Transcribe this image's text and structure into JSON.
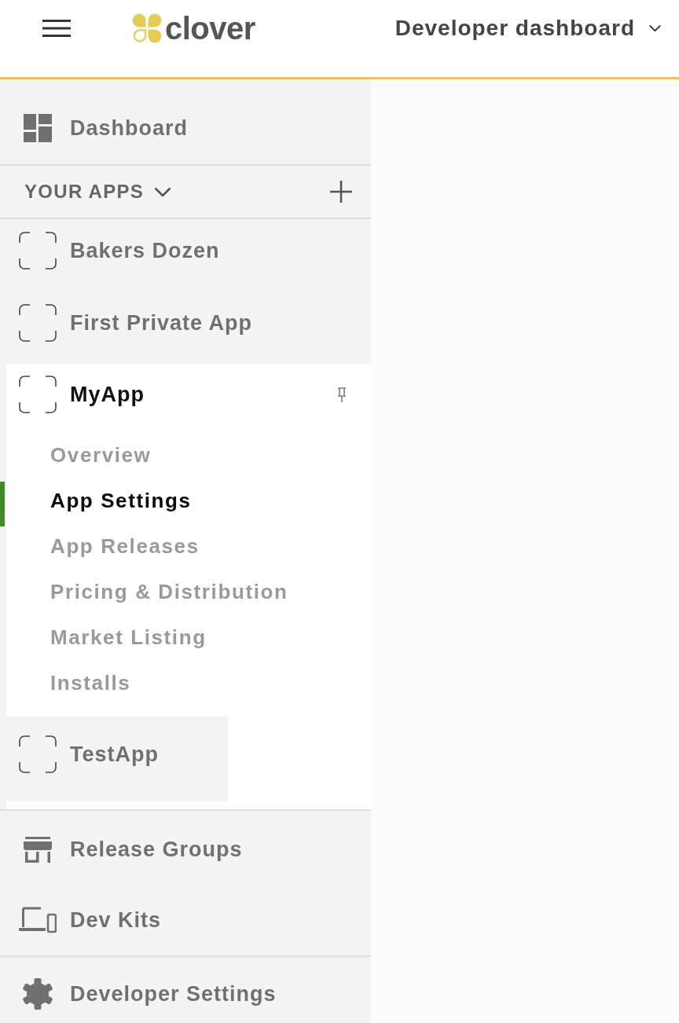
{
  "header": {
    "brand": "clover",
    "title": "Developer dashboard"
  },
  "sidebar": {
    "top_items": [
      {
        "label": "Dashboard",
        "kind": "dashboard"
      }
    ],
    "apps_section": {
      "label": "YOUR APPS",
      "expanded": true
    },
    "apps": [
      {
        "name": "Bakers Dozen",
        "expanded": false,
        "pinned": false,
        "dragging": false
      },
      {
        "name": "First Private App",
        "expanded": false,
        "pinned": false,
        "dragging": false
      },
      {
        "name": "MyApp",
        "expanded": true,
        "pinned": true,
        "dragging": false,
        "children": [
          {
            "label": "Overview",
            "selected": false
          },
          {
            "label": "App Settings",
            "selected": true
          },
          {
            "label": "App Releases",
            "selected": false
          },
          {
            "label": "Pricing & Distribution",
            "selected": false
          },
          {
            "label": "Market Listing",
            "selected": false
          },
          {
            "label": "Installs",
            "selected": false
          }
        ]
      },
      {
        "name": "TestApp",
        "expanded": false,
        "pinned": false,
        "dragging": true
      }
    ],
    "tools": [
      {
        "label": "Release Groups",
        "kind": "store"
      },
      {
        "label": "Dev Kits",
        "kind": "devices"
      }
    ],
    "footer_items": [
      {
        "label": "Developer Settings",
        "kind": "settings"
      }
    ]
  }
}
